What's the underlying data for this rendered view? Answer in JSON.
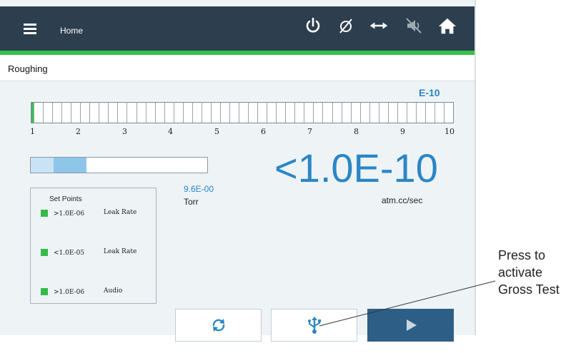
{
  "header": {
    "title": "Home",
    "icons": [
      "menu-icon",
      "power-icon",
      "null-icon",
      "bidirectional-arrow-icon",
      "speaker-muted-icon",
      "home-icon"
    ]
  },
  "status": {
    "mode": "Roughing"
  },
  "exponent_label": "E-10",
  "decade_scale": {
    "ticks": [
      "1",
      "2",
      "3",
      "4",
      "5",
      "6",
      "7",
      "8",
      "9",
      "10"
    ],
    "filled_segments": 0
  },
  "pressure": {
    "value": "9.6E-00",
    "unit": "Torr",
    "bar_fraction": 0.32
  },
  "leak_rate": {
    "value": "<1.0E-10",
    "unit": "atm.cc/sec"
  },
  "setpoints": {
    "title": "Set Points",
    "items": [
      {
        "value": ">1.0E-06",
        "type": "Leak Rate",
        "color": "#35b94b"
      },
      {
        "value": "<1.0E-05",
        "type": "Leak Rate",
        "color": "#35b94b"
      },
      {
        "value": ">1.0E-06",
        "type": "Audio",
        "color": "#35b94b"
      }
    ]
  },
  "buttons": [
    {
      "name": "refresh",
      "icon": "refresh-icon"
    },
    {
      "name": "gross-test",
      "icon": "usb-icon"
    },
    {
      "name": "start",
      "icon": "play-icon"
    }
  ],
  "callout": {
    "line1": "Press to",
    "line2": "activate",
    "line3": "Gross Test"
  },
  "colors": {
    "accent": "#2b86c5",
    "header": "#2d3e4e",
    "status_green": "#35c24a",
    "play_button": "#2d5f86"
  }
}
